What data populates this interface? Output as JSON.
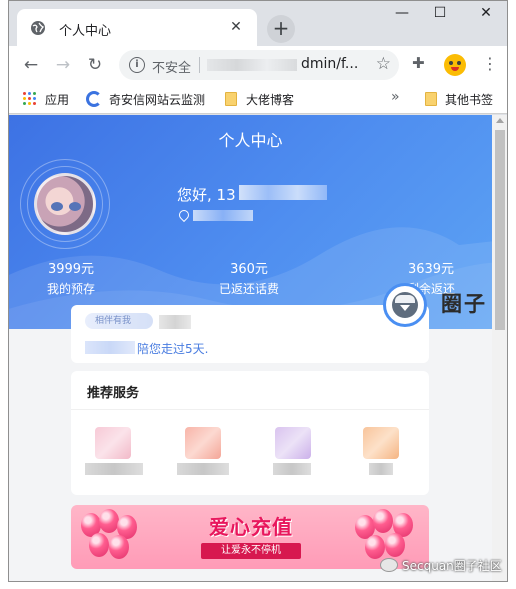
{
  "browser": {
    "tab_title": "个人中心",
    "new_tab_label": "+",
    "window_controls": {
      "minimize": "—",
      "maximize": "☐",
      "close": "✕"
    },
    "tab_close": "✕",
    "address": {
      "security_label": "不安全",
      "url_visible": "dmin/f...",
      "info_glyph": "i"
    },
    "nav": {
      "back": "←",
      "forward": "→",
      "reload": "↻"
    },
    "star_glyph": "☆",
    "puzzle_glyph": "✚",
    "menu_glyph": "⋮",
    "bookmarks": {
      "apps": "应用",
      "site_monitor": "奇安信网站云监测",
      "blog": "大佬博客",
      "overflow": "»",
      "other": "其他书签"
    }
  },
  "page": {
    "title": "个人中心",
    "greeting_prefix": "您好, 13",
    "stats": [
      {
        "value": "3999元",
        "label": "我的预存"
      },
      {
        "value": "360元",
        "label": "已返还话费"
      },
      {
        "value": "3639元",
        "label": "剩余返还"
      }
    ],
    "notice": {
      "tag": "相伴有我",
      "text": "陪您走过5天."
    },
    "services": {
      "title": "推荐服务"
    },
    "banner": {
      "title": "爱心充值",
      "subtitle": "让爱永不停机"
    }
  },
  "watermarks": {
    "quanzi": "圈子",
    "secquan": "Secquan圈子社区"
  },
  "colors": {
    "hero_start": "#3d72e4",
    "hero_end": "#5da3f4",
    "notice_link": "#4a7de0",
    "banner_pink": "#ff9bb7",
    "banner_red": "#e8175d"
  }
}
